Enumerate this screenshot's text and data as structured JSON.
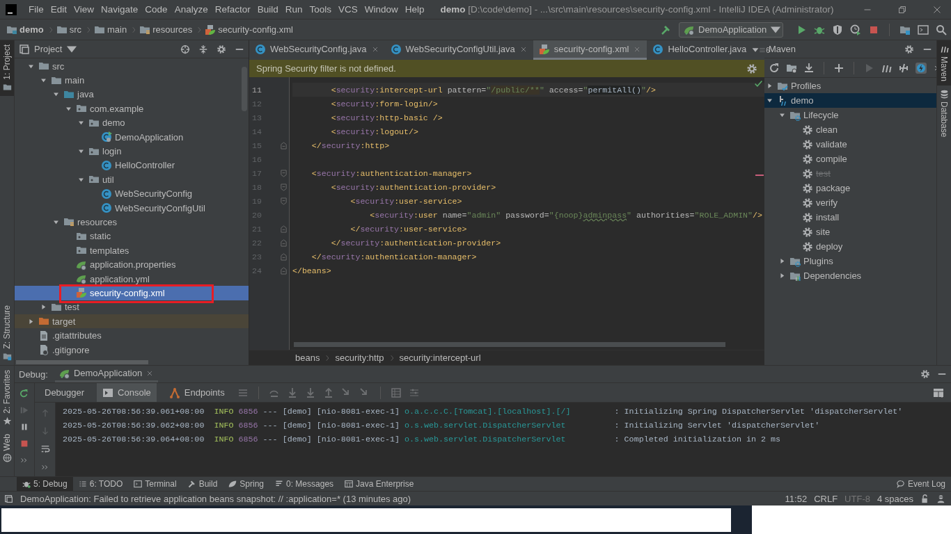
{
  "title_bar": {
    "menu": [
      "File",
      "Edit",
      "View",
      "Navigate",
      "Code",
      "Analyze",
      "Refactor",
      "Build",
      "Run",
      "Tools",
      "VCS",
      "Window",
      "Help"
    ],
    "title": "**demo** [D:\\code\\demo] - ...\\src\\main\\resources\\security-config.xml - IntelliJ IDEA (Administrator)"
  },
  "nav_bar": {
    "path": [
      {
        "label": "demo",
        "kind": "module"
      },
      {
        "label": "src",
        "kind": "folder"
      },
      {
        "label": "main",
        "kind": "folder"
      },
      {
        "label": "resources",
        "kind": "resources"
      },
      {
        "label": "security-config.xml",
        "kind": "xml"
      }
    ],
    "run_config": "DemoApplication"
  },
  "left_stripe": {
    "top": [
      {
        "label": "1: Project",
        "selected": true
      }
    ],
    "bottom": [
      {
        "label": "Z: Structure",
        "selected": false
      }
    ]
  },
  "project_panel": {
    "title": "Project",
    "tree": [
      {
        "label": "src",
        "kind": "folder",
        "expanded": true,
        "selected": false,
        "children": [
          {
            "label": "main",
            "kind": "folder",
            "expanded": true,
            "selected": false,
            "children": [
              {
                "label": "java",
                "kind": "source",
                "expanded": true,
                "selected": false,
                "children": [
                  {
                    "label": "com.example",
                    "kind": "package",
                    "expanded": true,
                    "selected": false,
                    "children": [
                      {
                        "label": "demo",
                        "kind": "package",
                        "expanded": true,
                        "selected": false,
                        "children": [
                          {
                            "label": "DemoApplication",
                            "kind": "spring-class",
                            "selected": false
                          }
                        ]
                      },
                      {
                        "label": "login",
                        "kind": "package",
                        "expanded": true,
                        "selected": false,
                        "children": [
                          {
                            "label": "HelloController",
                            "kind": "class",
                            "selected": false
                          }
                        ]
                      },
                      {
                        "label": "util",
                        "kind": "package",
                        "expanded": true,
                        "selected": false,
                        "children": [
                          {
                            "label": "WebSecurityConfig",
                            "kind": "class",
                            "selected": false
                          },
                          {
                            "label": "WebSecurityConfigUtil",
                            "kind": "class",
                            "selected": false
                          }
                        ]
                      }
                    ]
                  }
                ]
              },
              {
                "label": "resources",
                "kind": "resources",
                "expanded": true,
                "selected": false,
                "children": [
                  {
                    "label": "static",
                    "kind": "package",
                    "selected": false
                  },
                  {
                    "label": "templates",
                    "kind": "package",
                    "selected": false
                  },
                  {
                    "label": "application.properties",
                    "kind": "spring-file",
                    "selected": false
                  },
                  {
                    "label": "application.yml",
                    "kind": "spring-file",
                    "selected": false
                  },
                  {
                    "label": "security-config.xml",
                    "kind": "xml",
                    "selected": true,
                    "highlighted": true
                  }
                ]
              }
            ]
          },
          {
            "label": "test",
            "kind": "folder",
            "expanded": false,
            "selected": false
          }
        ]
      },
      {
        "label": "target",
        "kind": "excluded",
        "expanded": false,
        "selected": false
      },
      {
        "label": ".gitattributes",
        "kind": "file",
        "selected": false
      },
      {
        "label": ".gitignore",
        "kind": "ignore-file",
        "selected": false
      }
    ]
  },
  "editor": {
    "tabs": [
      {
        "label": "WebSecurityConfig.java",
        "kind": "class",
        "selected": false,
        "closable": true
      },
      {
        "label": "WebSecurityConfigUtil.java",
        "kind": "class",
        "selected": false,
        "closable": true
      },
      {
        "label": "security-config.xml",
        "kind": "xml",
        "selected": true,
        "closable": true
      },
      {
        "label": "HelloController.java",
        "kind": "class",
        "selected": false,
        "closable": false
      }
    ],
    "overflow_count": "6",
    "notice": "Spring Security filter is not defined.",
    "lines": [
      {
        "number": "11",
        "current": true,
        "tokens": [
          {
            "kind": "tag",
            "text": "        <"
          },
          {
            "kind": "ns",
            "text": "security"
          },
          {
            "kind": "tag",
            "text": ":intercept-url"
          },
          {
            "kind": "attr",
            "text": " pattern="
          },
          {
            "kind": "str",
            "text": "\""
          },
          {
            "kind": "strbg",
            "text": "/public/**"
          },
          {
            "kind": "str",
            "text": "\""
          },
          {
            "kind": "attr",
            "text": " access="
          },
          {
            "kind": "str",
            "text": "\""
          },
          {
            "kind": "plainbg",
            "text": "permitAll()"
          },
          {
            "kind": "str",
            "text": "\""
          },
          {
            "kind": "tag",
            "text": "/>"
          }
        ]
      },
      {
        "number": "12",
        "current": false,
        "tokens": [
          {
            "kind": "tag",
            "text": "        <"
          },
          {
            "kind": "ns",
            "text": "security"
          },
          {
            "kind": "tag",
            "text": ":form-login/>"
          }
        ]
      },
      {
        "number": "13",
        "current": false,
        "tokens": [
          {
            "kind": "tag",
            "text": "        <"
          },
          {
            "kind": "ns",
            "text": "security"
          },
          {
            "kind": "tag",
            "text": ":http-basic />"
          }
        ]
      },
      {
        "number": "14",
        "current": false,
        "tokens": [
          {
            "kind": "tag",
            "text": "        <"
          },
          {
            "kind": "ns",
            "text": "security"
          },
          {
            "kind": "tag",
            "text": ":logout/>"
          }
        ]
      },
      {
        "number": "15",
        "current": false,
        "fold": {
          "kind": "end"
        },
        "tokens": [
          {
            "kind": "tag",
            "text": "    </"
          },
          {
            "kind": "ns",
            "text": "security"
          },
          {
            "kind": "tag",
            "text": ":http>"
          }
        ]
      },
      {
        "number": "16",
        "current": false
      },
      {
        "number": "17",
        "current": false,
        "fold": {
          "kind": "start"
        },
        "tokens": [
          {
            "kind": "tag",
            "text": "    <"
          },
          {
            "kind": "ns",
            "text": "security"
          },
          {
            "kind": "tag",
            "text": ":authentication-manager>"
          }
        ]
      },
      {
        "number": "18",
        "current": false,
        "fold": {
          "kind": "start"
        },
        "tokens": [
          {
            "kind": "tag",
            "text": "        <"
          },
          {
            "kind": "ns",
            "text": "security"
          },
          {
            "kind": "tag",
            "text": ":authentication-provider>"
          }
        ]
      },
      {
        "number": "19",
        "current": false,
        "fold": {
          "kind": "start"
        },
        "tokens": [
          {
            "kind": "tag",
            "text": "            <"
          },
          {
            "kind": "ns",
            "text": "security"
          },
          {
            "kind": "tag",
            "text": ":user-service>"
          }
        ]
      },
      {
        "number": "20",
        "current": false,
        "tokens": [
          {
            "kind": "tag",
            "text": "                <"
          },
          {
            "kind": "ns",
            "text": "security"
          },
          {
            "kind": "tag",
            "text": ":user"
          },
          {
            "kind": "attr",
            "text": " name="
          },
          {
            "kind": "str",
            "text": "\"admin\""
          },
          {
            "kind": "attr",
            "text": " password="
          },
          {
            "kind": "str",
            "text": "\"{noop}"
          },
          {
            "kind": "typo",
            "text": "adminpass"
          },
          {
            "kind": "str",
            "text": "\""
          },
          {
            "kind": "attr",
            "text": " authorities="
          },
          {
            "kind": "str",
            "text": "\"ROLE_ADMIN\""
          },
          {
            "kind": "tag",
            "text": "/>"
          }
        ]
      },
      {
        "number": "21",
        "current": false,
        "fold": {
          "kind": "end"
        },
        "tokens": [
          {
            "kind": "tag",
            "text": "            </"
          },
          {
            "kind": "ns",
            "text": "security"
          },
          {
            "kind": "tag",
            "text": ":user-service>"
          }
        ]
      },
      {
        "number": "22",
        "current": false,
        "fold": {
          "kind": "end"
        },
        "tokens": [
          {
            "kind": "tag",
            "text": "        </"
          },
          {
            "kind": "ns",
            "text": "security"
          },
          {
            "kind": "tag",
            "text": ":authentication-provider>"
          }
        ]
      },
      {
        "number": "23",
        "current": false,
        "fold": {
          "kind": "end"
        },
        "tokens": [
          {
            "kind": "tag",
            "text": "    </"
          },
          {
            "kind": "ns",
            "text": "security"
          },
          {
            "kind": "tag",
            "text": ":authentication-manager>"
          }
        ]
      },
      {
        "number": "24",
        "current": false,
        "fold": {
          "kind": "end"
        },
        "tokens": [
          {
            "kind": "tag",
            "text": "</beans>"
          }
        ]
      }
    ],
    "breadcrumbs": [
      "beans",
      "security:http",
      "security:intercept-url"
    ]
  },
  "maven_panel": {
    "title": "Maven",
    "tree": [
      {
        "label": "Profiles",
        "kind": "profiles",
        "expanded": false,
        "selected": false
      },
      {
        "label": "demo",
        "kind": "project",
        "expanded": true,
        "selected": true,
        "children": [
          {
            "label": "Lifecycle",
            "kind": "lifecycle",
            "expanded": true,
            "selected": false,
            "children": [
              {
                "label": "clean",
                "kind": "goal",
                "selected": false,
                "skipped": false
              },
              {
                "label": "validate",
                "kind": "goal",
                "selected": false,
                "skipped": false
              },
              {
                "label": "compile",
                "kind": "goal",
                "selected": false,
                "skipped": false
              },
              {
                "label": "test",
                "kind": "goal",
                "selected": false,
                "skipped": true
              },
              {
                "label": "package",
                "kind": "goal",
                "selected": false,
                "skipped": false
              },
              {
                "label": "verify",
                "kind": "goal",
                "selected": false,
                "skipped": false
              },
              {
                "label": "install",
                "kind": "goal",
                "selected": false,
                "skipped": false
              },
              {
                "label": "site",
                "kind": "goal",
                "selected": false,
                "skipped": false
              },
              {
                "label": "deploy",
                "kind": "goal",
                "selected": false,
                "skipped": false
              }
            ]
          },
          {
            "label": "Plugins",
            "kind": "lifecycle",
            "expanded": false,
            "selected": false
          },
          {
            "label": "Dependencies",
            "kind": "dependencies",
            "expanded": false,
            "selected": false
          }
        ]
      }
    ]
  },
  "right_stripe": [
    {
      "label": "Maven",
      "kind": "maven",
      "selected": true
    },
    {
      "label": "Database",
      "kind": "database",
      "selected": false
    }
  ],
  "debug": {
    "label": "Debug:",
    "session": "DemoApplication",
    "stripe": [
      {
        "label": "2: Favorites",
        "kind": "star",
        "selected": false
      },
      {
        "label": "Web",
        "kind": "globe",
        "selected": false
      }
    ],
    "tabs": [
      {
        "label": "Debugger",
        "kind": "none",
        "selected": false
      },
      {
        "label": "Console",
        "kind": "console",
        "selected": true
      },
      {
        "label": "Endpoints",
        "kind": "endpoints",
        "selected": false
      }
    ],
    "console": [
      {
        "time": "2025-05-26T08:56:39.061+08:00",
        "level": "INFO",
        "pid": "6856",
        "thread": "--- [demo] [nio-8081-exec-1]",
        "logger": "o.a.c.c.C.[Tomcat].[localhost].[/]",
        "message": ": Initializing Spring DispatcherServlet 'dispatcherServlet'"
      },
      {
        "time": "2025-05-26T08:56:39.062+08:00",
        "level": "INFO",
        "pid": "6856",
        "thread": "--- [demo] [nio-8081-exec-1]",
        "logger": "o.s.web.servlet.DispatcherServlet",
        "message": ": Initializing Servlet 'dispatcherServlet'"
      },
      {
        "time": "2025-05-26T08:56:39.064+08:00",
        "level": "INFO",
        "pid": "6856",
        "thread": "--- [demo] [nio-8081-exec-1]",
        "logger": "o.s.web.servlet.DispatcherServlet",
        "message": ": Completed initialization in 2 ms"
      }
    ]
  },
  "tool_windows": [
    {
      "label": "5: Debug",
      "kind": "debug",
      "selected": true
    },
    {
      "label": "6: TODO",
      "kind": "todo",
      "selected": false
    },
    {
      "label": "Terminal",
      "kind": "terminal",
      "selected": false
    },
    {
      "label": "Build",
      "kind": "build",
      "selected": false
    },
    {
      "label": "Spring",
      "kind": "spring",
      "selected": false
    },
    {
      "label": "0: Messages",
      "kind": "messages",
      "selected": false
    },
    {
      "label": "Java Enterprise",
      "kind": "javaee",
      "selected": false
    }
  ],
  "event_log": "Event Log",
  "status_bar": {
    "message": "DemoApplication: Failed to retrieve application beans snapshot: // :application=* (13 minutes ago)",
    "items": [
      {
        "label": "11:52",
        "disabled": false
      },
      {
        "label": "CRLF",
        "disabled": false
      },
      {
        "label": "UTF-8",
        "disabled": true
      },
      {
        "label": "4 spaces",
        "disabled": false
      }
    ]
  }
}
